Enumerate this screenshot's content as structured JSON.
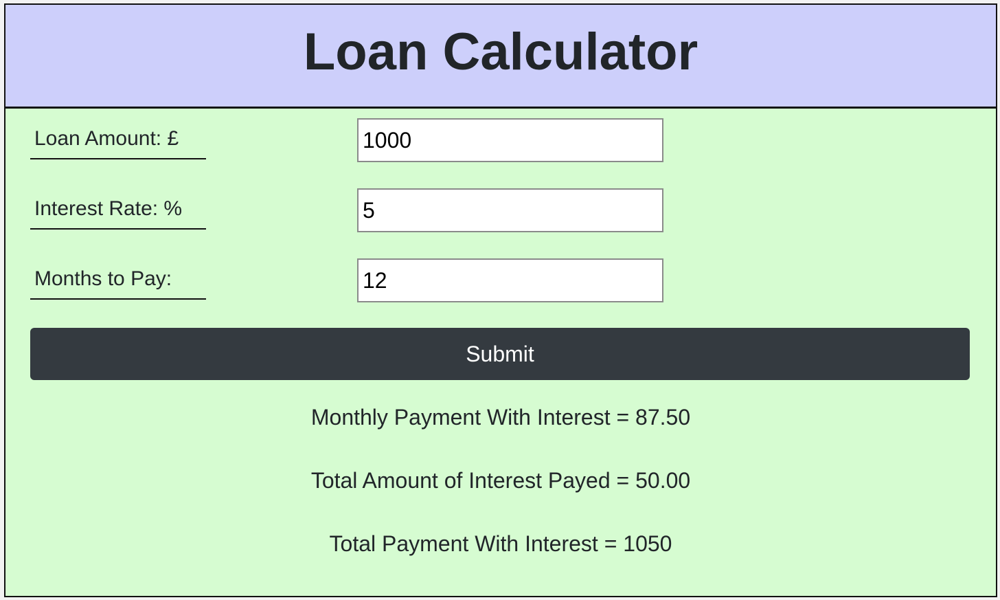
{
  "header": {
    "title": "Loan Calculator"
  },
  "form": {
    "loan_amount": {
      "label": "Loan Amount: £",
      "value": "1000"
    },
    "interest_rate": {
      "label": "Interest Rate: %",
      "value": "5"
    },
    "months": {
      "label": "Months to Pay:",
      "value": "12"
    },
    "submit_label": "Submit"
  },
  "results": {
    "monthly_payment": "Monthly Payment With Interest = 87.50",
    "total_interest": "Total Amount of Interest Payed = 50.00",
    "total_payment": "Total Payment With Interest = 1050"
  },
  "colors": {
    "header_bg": "#cdcffb",
    "body_bg": "#d6fcd1",
    "button_bg": "#343a40",
    "text": "#212529"
  }
}
